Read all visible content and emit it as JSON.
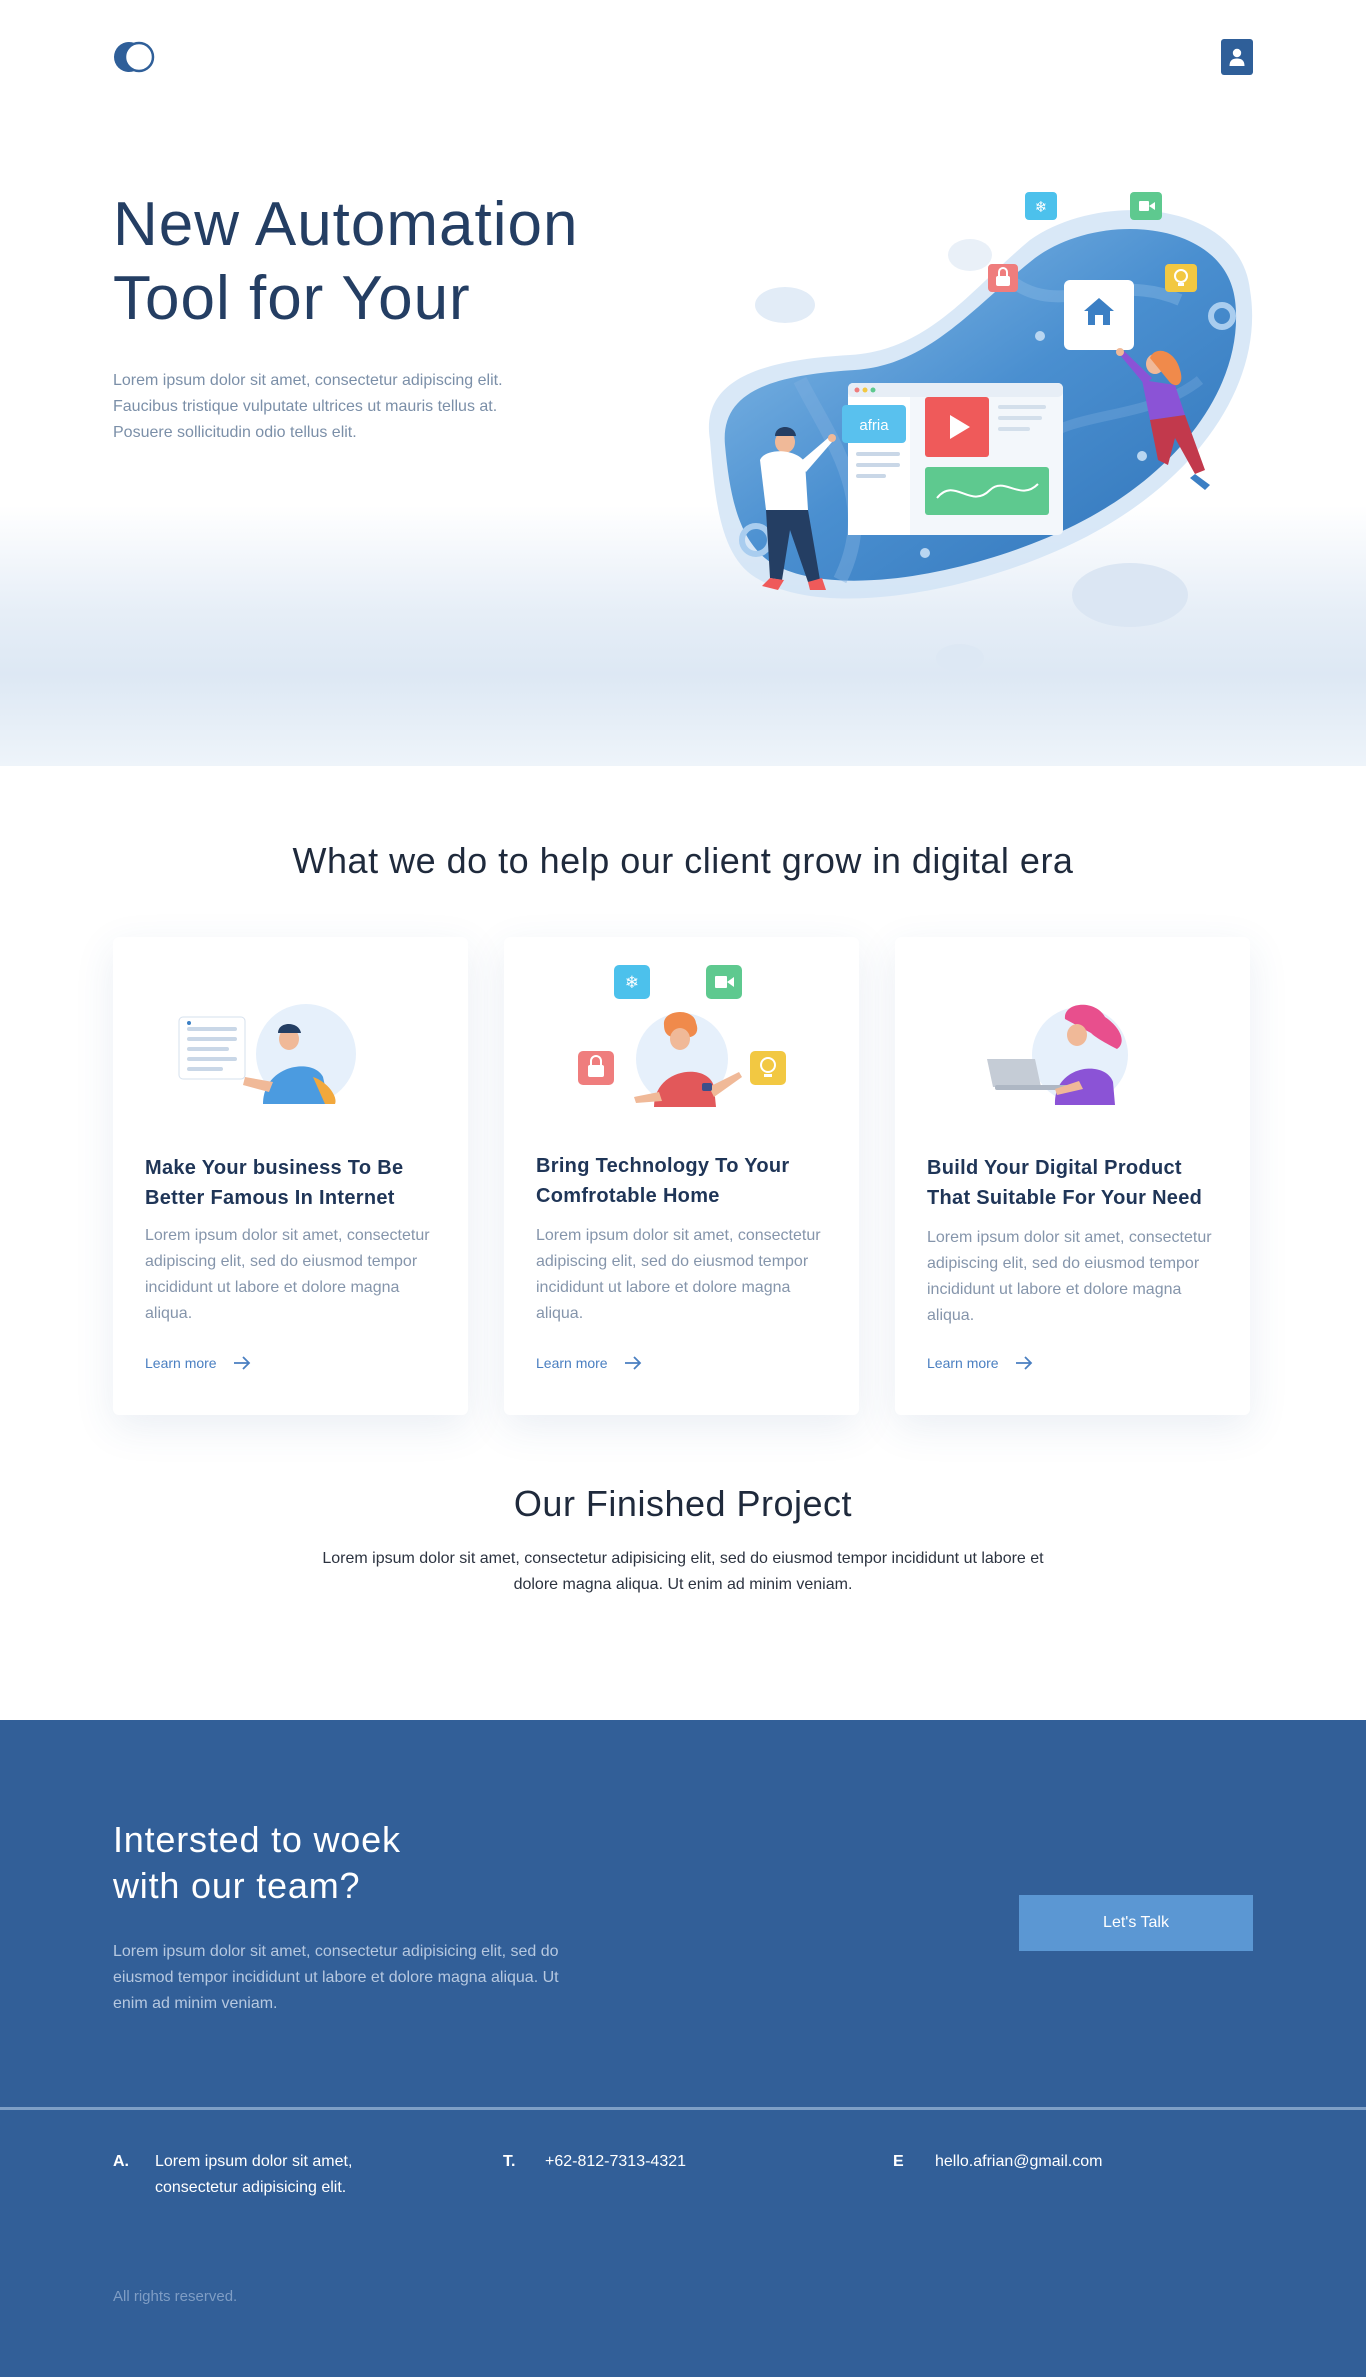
{
  "nav": {
    "logo_icon": "brand-logo-icon",
    "account_icon": "user-icon"
  },
  "hero": {
    "title_line1": "New Automation",
    "title_line2": "Tool for Your",
    "description": "Lorem ipsum dolor sit amet, consectetur adipiscing elit. Faucibus tristique vulputate ultrices ut mauris tellus at. Posuere sollicitudin odio tellus elit.",
    "illustration_badge": "afria"
  },
  "services": {
    "title": "What we do to help our client grow in digital era",
    "cards": [
      {
        "title": "Make Your business To Be Better Famous In Internet",
        "description": "Lorem ipsum dolor sit amet, consectetur adipiscing elit, sed do eiusmod tempor incididunt ut labore et dolore magna aliqua.",
        "link": "Learn more"
      },
      {
        "title": "Bring Technology To Your Comfrotable Home",
        "description": "Lorem ipsum dolor sit amet, consectetur adipiscing elit, sed do eiusmod tempor incididunt ut labore et dolore magna aliqua.",
        "link": "Learn more"
      },
      {
        "title": "Build Your Digital Product That Suitable For Your Need",
        "description": "Lorem ipsum dolor sit amet, consectetur adipiscing elit, sed do eiusmod tempor incididunt ut labore et dolore magna aliqua.",
        "link": "Learn more"
      }
    ]
  },
  "projects": {
    "title": "Our Finished Project",
    "description": "Lorem ipsum dolor sit amet, consectetur adipisicing elit, sed do eiusmod tempor incididunt ut labore et dolore magna aliqua. Ut enim ad minim veniam."
  },
  "cta": {
    "title_line1": "Intersted to woek",
    "title_line2": "with our team?",
    "description": "Lorem ipsum dolor sit amet, consectetur adipisicing elit, sed do eiusmod tempor incididunt ut labore et dolore magna aliqua. Ut enim ad minim veniam.",
    "button": "Let's Talk"
  },
  "contact": {
    "address_key": "A.",
    "address_line1": "Lorem ipsum dolor sit amet,",
    "address_line2": "consectetur adipisicing elit.",
    "phone_key": "T.",
    "phone": "+62-812-7313-4321",
    "email_key": "E",
    "email": "hello.afrian@gmail.com"
  },
  "footer": {
    "copyright": "All rights reserved."
  },
  "colors": {
    "primary": "#325f98",
    "accent": "#5b97d3",
    "heading": "#243e63",
    "link": "#4a7fc1"
  }
}
